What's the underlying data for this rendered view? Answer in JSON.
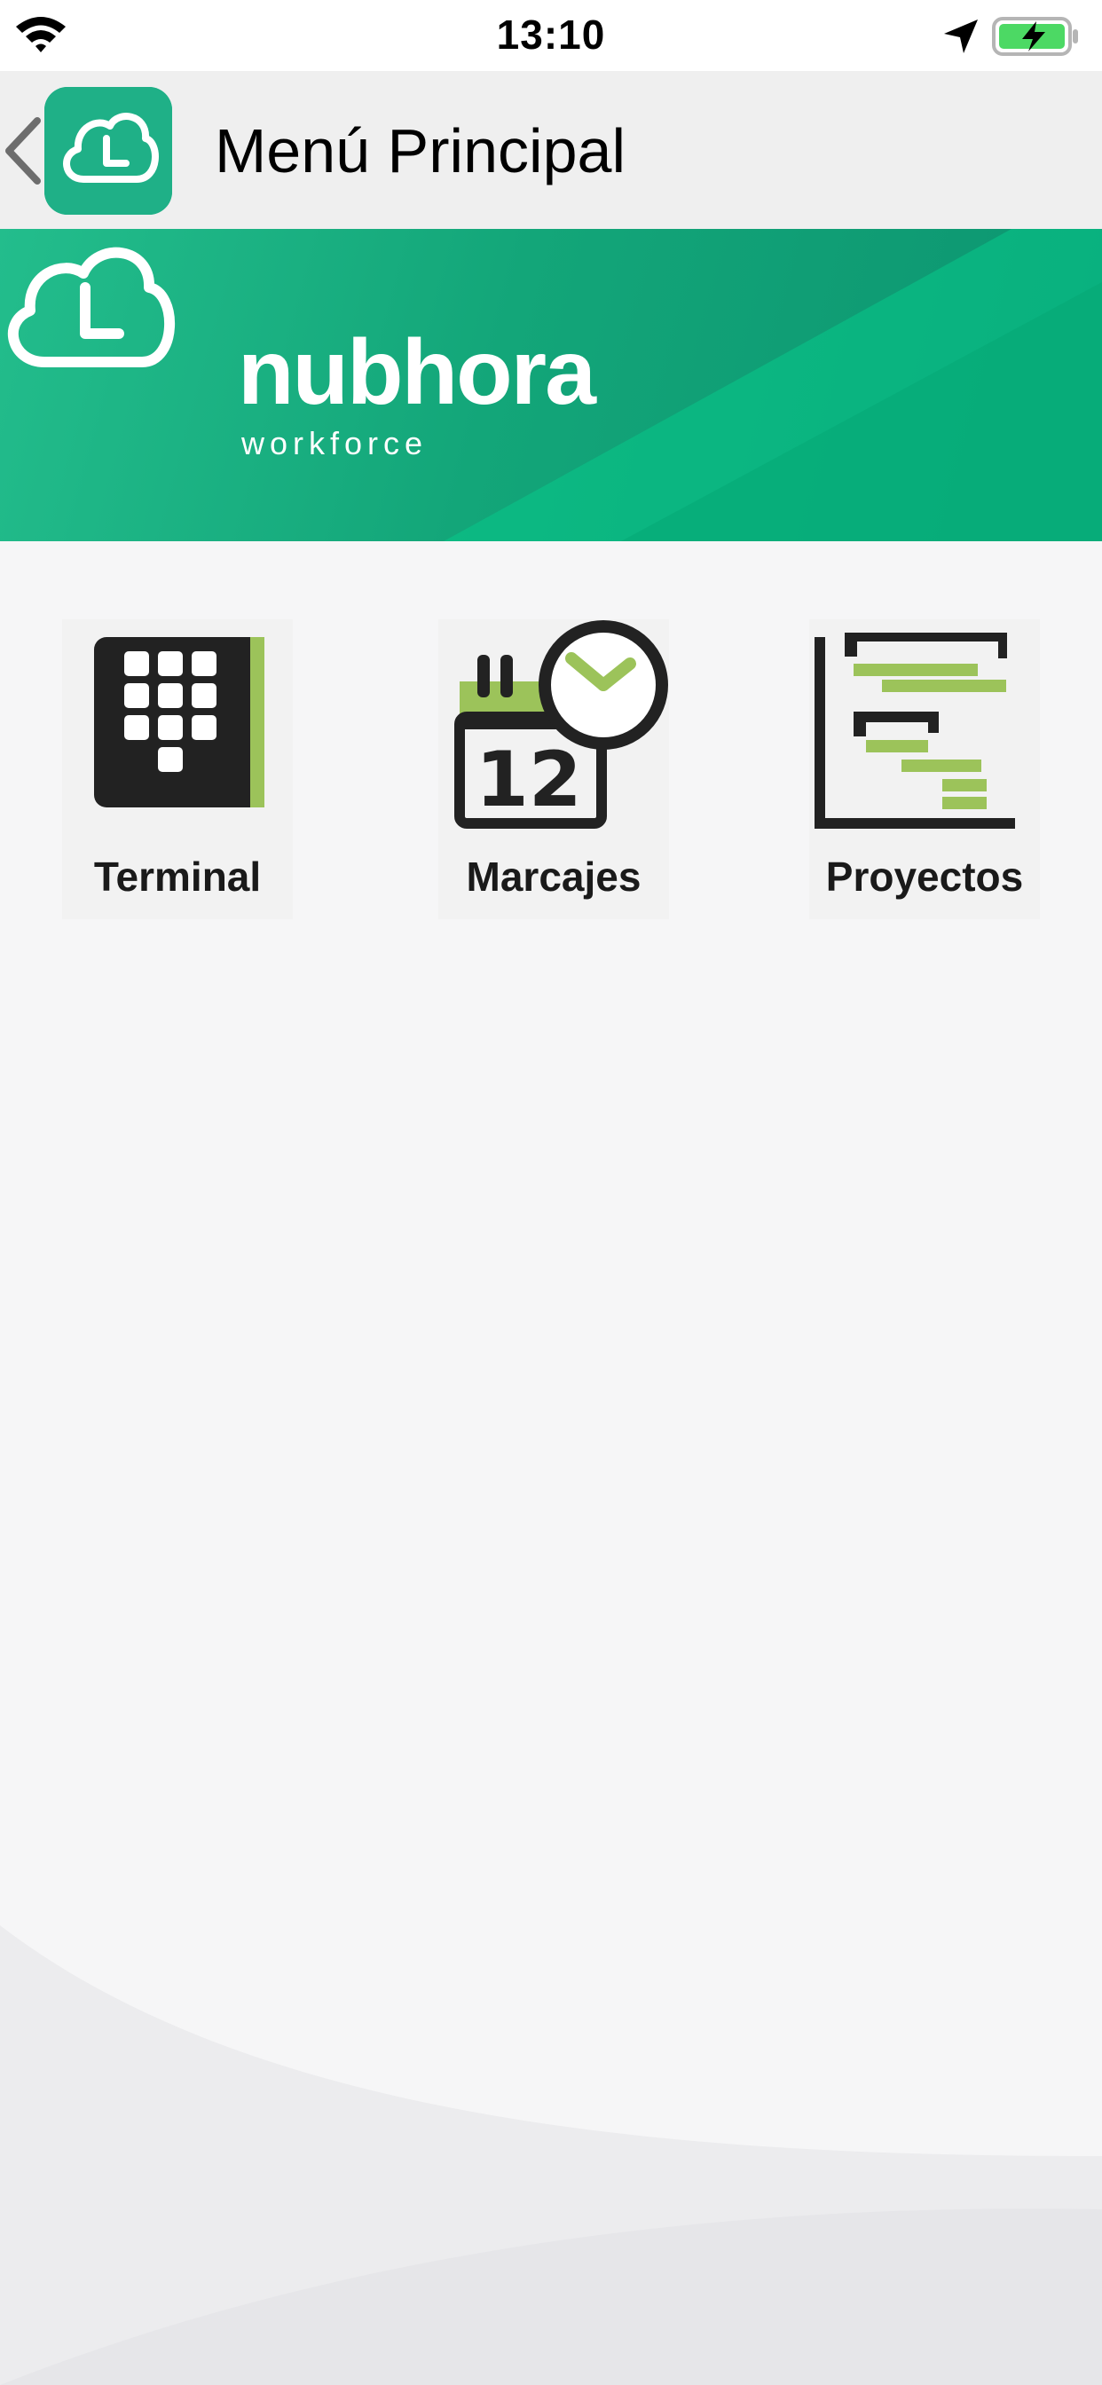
{
  "status_bar": {
    "time": "13:10",
    "wifi_icon": "wifi-icon",
    "location_icon": "location-arrow-icon",
    "battery_icon": "battery-charging-icon"
  },
  "nav_bar": {
    "back_icon": "chevron-left-icon",
    "app_icon": "nubhora-cloud-clock-icon",
    "title": "Menú Principal"
  },
  "banner": {
    "brand_name": "nubhora",
    "brand_tagline": "workforce",
    "logo_icon": "cloud-clock-icon"
  },
  "menu": {
    "items": [
      {
        "label": "Terminal",
        "icon": "keypad-terminal-icon"
      },
      {
        "label": "Marcajes",
        "icon": "calendar-clock-icon"
      },
      {
        "label": "Proyectos",
        "icon": "gantt-chart-icon"
      }
    ]
  },
  "colors": {
    "brand_green": "#1fb087",
    "accent_lime": "#9cc35a",
    "icon_dark": "#222222",
    "nav_bg": "#efefef",
    "page_bg": "#f6f6f7"
  }
}
